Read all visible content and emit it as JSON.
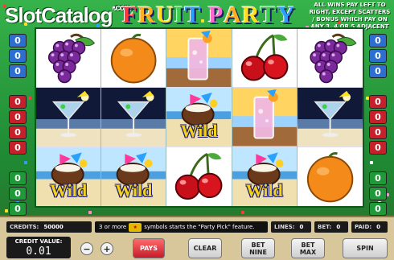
{
  "header": {
    "logo_text": "SlotCatalog",
    "logo_domain": ".com",
    "title_letters": [
      "F",
      "R",
      "U",
      "I",
      "T",
      " ",
      "P",
      "A",
      "R",
      "T",
      "Y"
    ],
    "title_colors": [
      "#ff3a3a",
      "#ffb020",
      "#ffe020",
      "#3ad04a",
      "#2aa0ff",
      "#ffffff",
      "#ff6ad0",
      "#ffb020",
      "#ffe020",
      "#3ad04a",
      "#2aa0ff"
    ],
    "rules_text": "ALL WINS PAY LEFT TO RIGHT, EXCEPT SCATTERS / BONUS WHICH PAY ON ANY 3, 4 OR 5 ADJACENT REELS"
  },
  "paylines": {
    "left": [
      {
        "label": "0",
        "color": "blue"
      },
      {
        "label": "0",
        "color": "blue"
      },
      {
        "label": "0",
        "color": "blue"
      },
      {
        "label": "",
        "color": "gap"
      },
      {
        "label": "0",
        "color": "red"
      },
      {
        "label": "0",
        "color": "red"
      },
      {
        "label": "0",
        "color": "red"
      },
      {
        "label": "0",
        "color": "red"
      },
      {
        "label": "",
        "color": "gap"
      },
      {
        "label": "0",
        "color": "green"
      },
      {
        "label": "0",
        "color": "green"
      },
      {
        "label": "0",
        "color": "green"
      }
    ],
    "right": [
      {
        "label": "0",
        "color": "blue"
      },
      {
        "label": "0",
        "color": "blue"
      },
      {
        "label": "0",
        "color": "blue"
      },
      {
        "label": "",
        "color": "gap"
      },
      {
        "label": "0",
        "color": "red"
      },
      {
        "label": "0",
        "color": "red"
      },
      {
        "label": "0",
        "color": "red"
      },
      {
        "label": "0",
        "color": "red"
      },
      {
        "label": "",
        "color": "gap"
      },
      {
        "label": "0",
        "color": "green"
      },
      {
        "label": "0",
        "color": "green"
      },
      {
        "label": "0",
        "color": "green"
      }
    ]
  },
  "reels": [
    [
      "grapes",
      "martini",
      "wild"
    ],
    [
      "orange",
      "martini",
      "wild"
    ],
    [
      "cocktail",
      "wild",
      "cherries"
    ],
    [
      "cherries",
      "cocktail",
      "wild"
    ],
    [
      "grapes",
      "martini",
      "orange"
    ]
  ],
  "wild_label": "Wild",
  "info": {
    "credits_label": "CREDITS:",
    "credits_value": "50000",
    "feature_prefix": "3 or more",
    "feature_suffix": "symbols starts the \"Party Pick\" feature.",
    "lines_label": "LINES:",
    "lines_value": "0",
    "bet_label": "BET:",
    "bet_value": "0",
    "paid_label": "PAID:",
    "paid_value": "0"
  },
  "controls": {
    "credit_value_label": "CREDIT VALUE:",
    "credit_value": "0.01",
    "minus": "−",
    "plus": "+",
    "pays": "PAYS",
    "clear": "CLEAR",
    "bet_nine": "BET NINE",
    "bet_max": "BET MAX",
    "spin": "SPIN"
  }
}
